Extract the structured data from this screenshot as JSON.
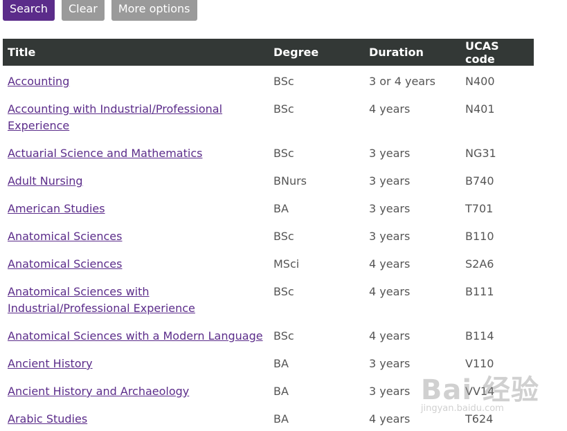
{
  "buttons": {
    "search": "Search",
    "clear": "Clear",
    "more": "More options"
  },
  "table": {
    "headers": {
      "title": "Title",
      "degree": "Degree",
      "duration": "Duration",
      "ucas": "UCAS code"
    },
    "rows": [
      {
        "title": "Accounting",
        "degree": "BSc",
        "duration": "3 or 4 years",
        "ucas": "N400"
      },
      {
        "title": "Accounting with Industrial/Professional Experience",
        "degree": "BSc",
        "duration": "4 years",
        "ucas": "N401"
      },
      {
        "title": "Actuarial Science and Mathematics",
        "degree": "BSc",
        "duration": "3 years",
        "ucas": "NG31"
      },
      {
        "title": "Adult Nursing",
        "degree": "BNurs",
        "duration": "3 years",
        "ucas": "B740"
      },
      {
        "title": "American Studies",
        "degree": "BA",
        "duration": "3 years",
        "ucas": "T701"
      },
      {
        "title": "Anatomical Sciences",
        "degree": "BSc",
        "duration": "3 years",
        "ucas": "B110"
      },
      {
        "title": "Anatomical Sciences",
        "degree": "MSci",
        "duration": "4 years",
        "ucas": "S2A6"
      },
      {
        "title": "Anatomical Sciences with Industrial/Professional Experience",
        "degree": "BSc",
        "duration": "4 years",
        "ucas": "B111"
      },
      {
        "title": "Anatomical Sciences with a Modern Language",
        "degree": "BSc",
        "duration": "4 years",
        "ucas": "B114"
      },
      {
        "title": "Ancient History",
        "degree": "BA",
        "duration": "3 years",
        "ucas": "V110"
      },
      {
        "title": "Ancient History and Archaeology",
        "degree": "BA",
        "duration": "3 years",
        "ucas": "VV14"
      },
      {
        "title": "Arabic Studies",
        "degree": "BA",
        "duration": "4 years",
        "ucas": "T624"
      }
    ]
  },
  "watermark": {
    "logo": "Bai 经验",
    "url": "jingyan.baidu.com"
  }
}
